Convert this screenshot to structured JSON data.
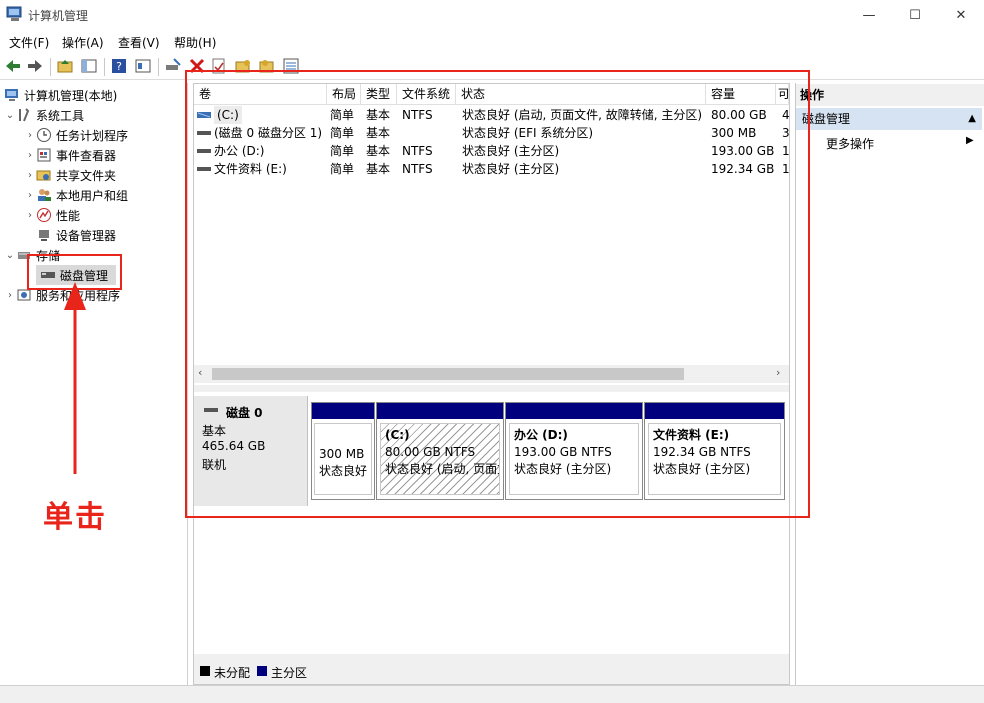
{
  "window": {
    "title": "计算机管理",
    "controls": {
      "minimize": "—",
      "maximize": "☐",
      "close": "✕"
    }
  },
  "menu": [
    "文件(F)",
    "操作(A)",
    "查看(V)",
    "帮助(H)"
  ],
  "tree": {
    "root": "计算机管理(本地)",
    "system_tools": "系统工具",
    "task_scheduler": "任务计划程序",
    "event_viewer": "事件查看器",
    "shared_folders": "共享文件夹",
    "local_users": "本地用户和组",
    "performance": "性能",
    "device_manager": "设备管理器",
    "storage": "存储",
    "disk_management": "磁盘管理",
    "services_apps": "服务和应用程序"
  },
  "volumes": {
    "headers": [
      "卷",
      "布局",
      "类型",
      "文件系统",
      "状态",
      "容量",
      "可"
    ],
    "rows": [
      {
        "name": "(C:)",
        "layout": "简单",
        "type": "基本",
        "fs": "NTFS",
        "status": "状态良好 (启动, 页面文件, 故障转储, 主分区)",
        "capacity": "80.00 GB",
        "extra": "4"
      },
      {
        "name": "(磁盘 0 磁盘分区 1)",
        "layout": "简单",
        "type": "基本",
        "fs": "",
        "status": "状态良好 (EFI 系统分区)",
        "capacity": "300 MB",
        "extra": "3"
      },
      {
        "name": "办公 (D:)",
        "layout": "简单",
        "type": "基本",
        "fs": "NTFS",
        "status": "状态良好 (主分区)",
        "capacity": "193.00 GB",
        "extra": "1"
      },
      {
        "name": "文件资料 (E:)",
        "layout": "简单",
        "type": "基本",
        "fs": "NTFS",
        "status": "状态良好 (主分区)",
        "capacity": "192.34 GB",
        "extra": "1"
      }
    ]
  },
  "disk": {
    "name": "磁盘 0",
    "kind": "基本",
    "size": "465.64 GB",
    "state": "联机",
    "partitions": [
      {
        "title": "",
        "line1": "300 MB",
        "line2": "状态良好"
      },
      {
        "title": "(C:)",
        "line1": "80.00 GB NTFS",
        "line2": "状态良好 (启动, 页面文件"
      },
      {
        "title": "办公  (D:)",
        "line1": "193.00 GB NTFS",
        "line2": "状态良好 (主分区)"
      },
      {
        "title": "文件资料  (E:)",
        "line1": "192.34 GB NTFS",
        "line2": "状态良好 (主分区)"
      }
    ]
  },
  "legend": {
    "unallocated": "未分配",
    "primary": "主分区"
  },
  "actions": {
    "header": "操作",
    "section": "磁盘管理",
    "more": "更多操作"
  },
  "annotation": {
    "text": "单击"
  },
  "colors": {
    "primary_partition": "#00007f",
    "annotation": "#e8241b"
  }
}
